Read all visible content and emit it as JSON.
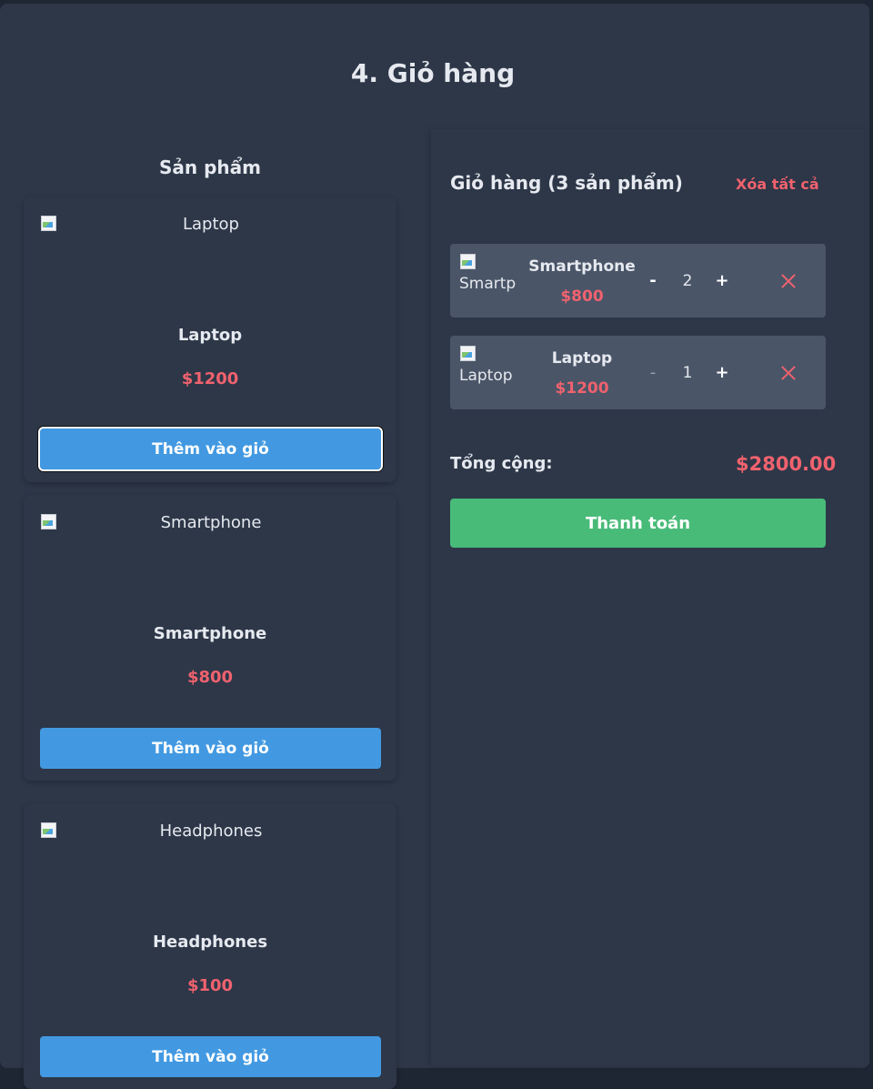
{
  "page": {
    "title": "4. Giỏ hàng"
  },
  "products": {
    "title": "Sản phẩm",
    "items": [
      {
        "name": "Laptop",
        "image_alt": "Laptop",
        "price": "$1200",
        "add_label": "Thêm vào giỏ"
      },
      {
        "name": "Smartphone",
        "image_alt": "Smartphone",
        "price": "$800",
        "add_label": "Thêm vào giỏ"
      },
      {
        "name": "Headphones",
        "image_alt": "Headphones",
        "price": "$100",
        "add_label": "Thêm vào giỏ"
      }
    ]
  },
  "cart": {
    "title": "Giỏ hàng (3 sản phẩm)",
    "clear_label": "Xóa tất cả",
    "items": [
      {
        "name": "Smartphone",
        "image_alt": "Smartp",
        "price": "$800",
        "qty": "2",
        "minus": "-",
        "plus": "+"
      },
      {
        "name": "Laptop",
        "image_alt": "Laptop",
        "price": "$1200",
        "qty": "1",
        "minus": "-",
        "plus": "+"
      }
    ],
    "total_label": "Tổng cộng:",
    "total_value": "$2800.00",
    "checkout_label": "Thanh toán"
  },
  "colors": {
    "accent_blue": "#4299e1",
    "price_red": "#f0626e",
    "checkout_green": "#48bb78",
    "panel": "#2d3748"
  },
  "icons": {
    "remove": "close-icon",
    "broken_image": "broken-image-icon"
  }
}
